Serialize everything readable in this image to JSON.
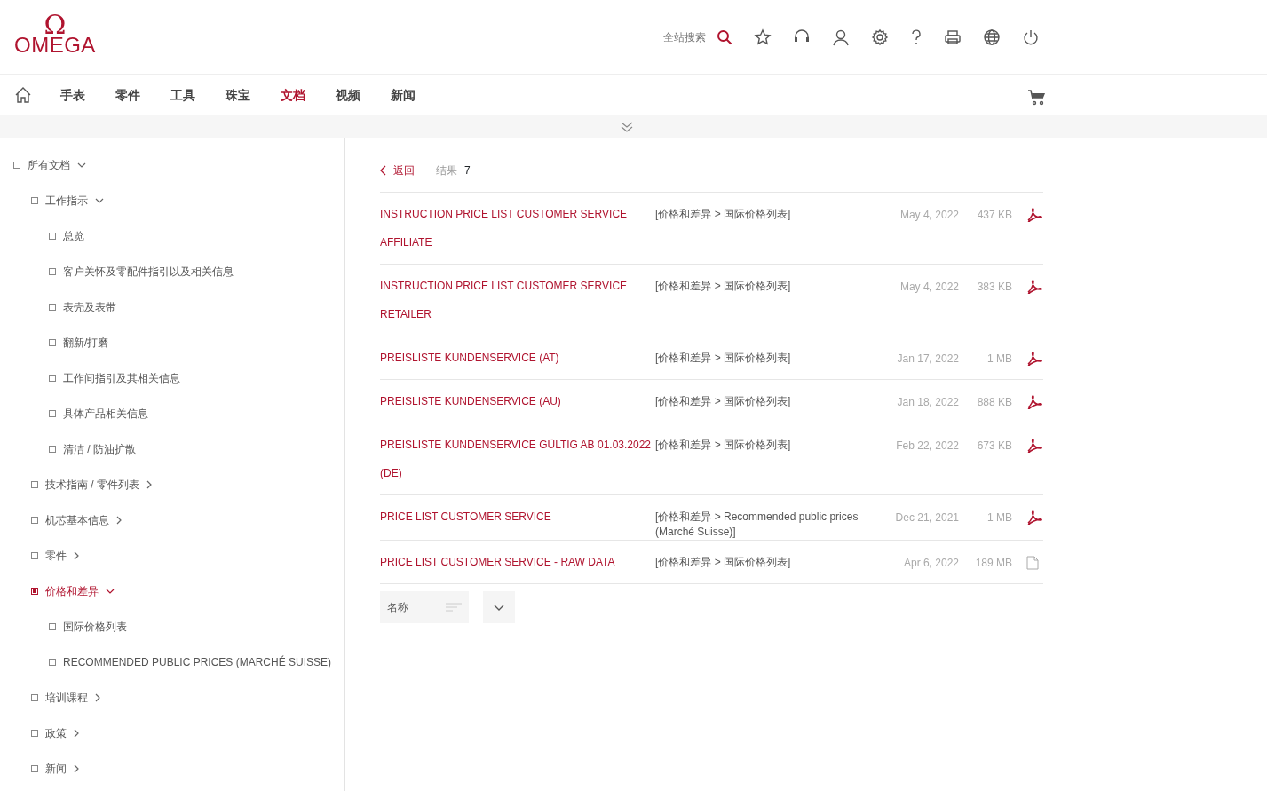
{
  "logo": {
    "symbol": "Ω",
    "wordmark": "OMEGA"
  },
  "search": {
    "placeholder": "全站搜索"
  },
  "nav": [
    {
      "label": "手表",
      "selected": false
    },
    {
      "label": "零件",
      "selected": false
    },
    {
      "label": "工具",
      "selected": false
    },
    {
      "label": "珠宝",
      "selected": false
    },
    {
      "label": "文档",
      "selected": true
    },
    {
      "label": "视频",
      "selected": false
    },
    {
      "label": "新闻",
      "selected": false
    }
  ],
  "sidebar": {
    "items": [
      {
        "label": "所有文档",
        "selected": false,
        "expanded": true,
        "children": [
          {
            "label": "工作指示",
            "selected": false,
            "expanded": true,
            "children": [
              {
                "label": "总览",
                "selected": false
              },
              {
                "label": "客户关怀及零配件指引以及相关信息",
                "selected": false
              },
              {
                "label": "表壳及表带",
                "selected": false
              },
              {
                "label": "翻新/打磨",
                "selected": false
              },
              {
                "label": "工作间指引及其相关信息",
                "selected": false
              },
              {
                "label": "具体产品相关信息",
                "selected": false
              },
              {
                "label": "清洁 / 防油扩散",
                "selected": false
              }
            ]
          },
          {
            "label": "技术指南 / 零件列表",
            "selected": false,
            "expanded": false
          },
          {
            "label": "机芯基本信息",
            "selected": false,
            "expanded": false
          },
          {
            "label": "零件",
            "selected": false,
            "expanded": false
          },
          {
            "label": "价格和差异",
            "selected": true,
            "expanded": true,
            "children": [
              {
                "label": "国际价格列表",
                "selected": false
              },
              {
                "label": "RECOMMENDED PUBLIC PRICES (MARCHÉ SUISSE)",
                "selected": false
              }
            ]
          },
          {
            "label": "培训课程",
            "selected": false,
            "expanded": false
          },
          {
            "label": "政策",
            "selected": false,
            "expanded": false
          },
          {
            "label": "新闻",
            "selected": false,
            "expanded": false
          }
        ]
      }
    ]
  },
  "results": {
    "back": "返回",
    "count_label": "结果",
    "count": "7"
  },
  "documents": [
    {
      "title": "INSTRUCTION PRICE LIST CUSTOMER SERVICE AFFILIATE",
      "category": "[价格和差异 > 国际价格列表]",
      "date": "May 4, 2022",
      "size": "437 KB",
      "kind": "pdf"
    },
    {
      "title": "INSTRUCTION PRICE LIST CUSTOMER SERVICE RETAILER",
      "category": "[价格和差异 > 国际价格列表]",
      "date": "May 4, 2022",
      "size": "383 KB",
      "kind": "pdf"
    },
    {
      "title": "PREISLISTE KUNDENSERVICE (AT)",
      "category": "[价格和差异 > 国际价格列表]",
      "date": "Jan 17, 2022",
      "size": "1 MB",
      "kind": "pdf"
    },
    {
      "title": "PREISLISTE KUNDENSERVICE (AU)",
      "category": "[价格和差异 > 国际价格列表]",
      "date": "Jan 18, 2022",
      "size": "888 KB",
      "kind": "pdf"
    },
    {
      "title": "PREISLISTE KUNDENSERVICE GÜLTIG AB 01.03.2022 (DE)",
      "category": "[价格和差异 > 国际价格列表]",
      "date": "Feb 22, 2022",
      "size": "673 KB",
      "kind": "pdf"
    },
    {
      "title": "PRICE LIST CUSTOMER SERVICE",
      "category": "[价格和差异 > Recommended public prices (Marché Suisse)]",
      "date": "Dec 21, 2021",
      "size": "1 MB",
      "kind": "pdf"
    },
    {
      "title": "PRICE LIST CUSTOMER SERVICE - RAW DATA",
      "category": "[价格和差异 > 国际价格列表]",
      "date": "Apr 6, 2022",
      "size": "189 MB",
      "kind": "file"
    }
  ],
  "sort": {
    "label": "名称"
  }
}
